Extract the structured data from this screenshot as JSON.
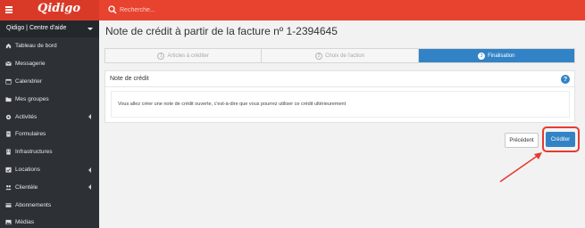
{
  "topbar": {
    "logo": "Qidigo",
    "search_placeholder": "Recherche..."
  },
  "sidebar": {
    "org": "Qidigo | Centre d'aide",
    "items": [
      {
        "label": "Tableau de bord",
        "icon": "dashboard-icon"
      },
      {
        "label": "Messagerie",
        "icon": "envelope-icon"
      },
      {
        "label": "Calendrier",
        "icon": "calendar-icon"
      },
      {
        "label": "Mes groupes",
        "icon": "folder-icon"
      },
      {
        "label": "Activités",
        "icon": "gear-icon"
      },
      {
        "label": "Formulaires",
        "icon": "document-icon"
      },
      {
        "label": "Infrastructures",
        "icon": "building-icon"
      },
      {
        "label": "Locations",
        "icon": "calendar-check-icon"
      },
      {
        "label": "Clientèle",
        "icon": "users-icon"
      },
      {
        "label": "Abonnements",
        "icon": "card-icon"
      },
      {
        "label": "Médias",
        "icon": "image-icon"
      }
    ]
  },
  "main": {
    "title": "Note de crédit à partir de la facture nº 1-2394645",
    "steps": [
      {
        "num": "1",
        "label": "Articles à créditer"
      },
      {
        "num": "2",
        "label": "Choix de l'action"
      },
      {
        "num": "3",
        "label": "Finalisation"
      }
    ],
    "panel_title": "Note de crédit",
    "help": "?",
    "notice": "Vous allez créer une note de crédit ouverte, c'est-à-dire que vous pourrez utiliser ce crédit ultérieurement",
    "prev_label": "Précédent",
    "credit_label": "Créditer"
  },
  "colors": {
    "topbar": "#e8432f",
    "sidebar": "#2d3136",
    "accent": "#3283c6",
    "highlight": "#e63b30"
  }
}
